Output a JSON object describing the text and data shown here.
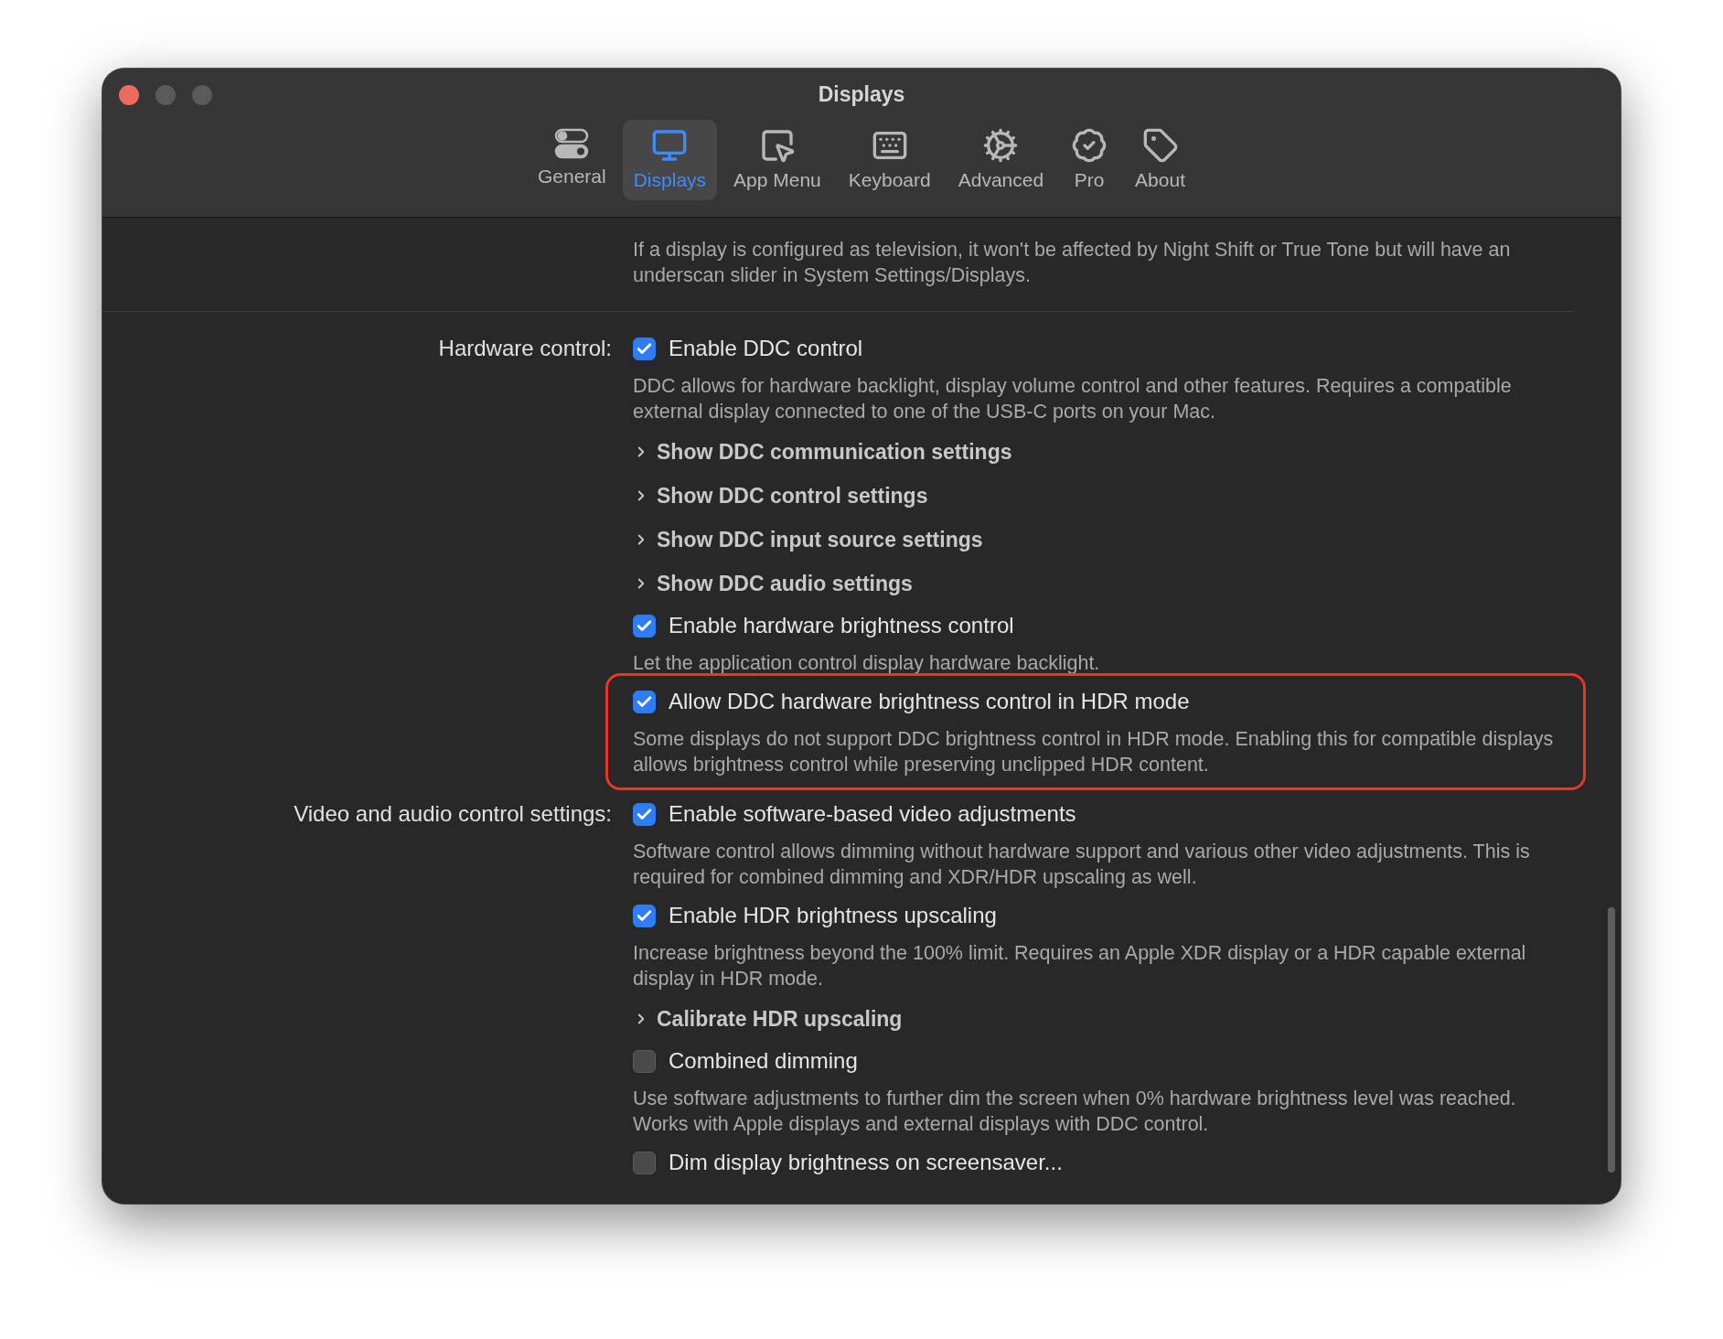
{
  "window": {
    "title": "Displays"
  },
  "tabs": [
    {
      "label": "General",
      "selected": false
    },
    {
      "label": "Displays",
      "selected": true
    },
    {
      "label": "App Menu",
      "selected": false
    },
    {
      "label": "Keyboard",
      "selected": false
    },
    {
      "label": "Advanced",
      "selected": false
    },
    {
      "label": "Pro",
      "selected": false
    },
    {
      "label": "About",
      "selected": false
    }
  ],
  "sections": [
    {
      "items": [
        {
          "kind": "note",
          "description": "If a display is configured as television, it won't be affected by Night Shift or True Tone but will have an underscan slider in System Settings/Displays."
        }
      ]
    },
    {
      "label": "Hardware control:",
      "items": [
        {
          "kind": "checkbox",
          "label": "Enable DDC control",
          "checked": true,
          "highlighted": false,
          "description": "DDC allows for hardware backlight, display volume control and other features. Requires a compatible external display connected to one of the USB-C ports on your Mac."
        },
        {
          "kind": "disclosure",
          "label": "Show DDC communication settings",
          "expanded": false
        },
        {
          "kind": "disclosure",
          "label": "Show DDC control settings",
          "expanded": false
        },
        {
          "kind": "disclosure",
          "label": "Show DDC input source settings",
          "expanded": false
        },
        {
          "kind": "disclosure",
          "label": "Show DDC audio settings",
          "expanded": false
        },
        {
          "kind": "checkbox",
          "label": "Enable hardware brightness control",
          "checked": true,
          "highlighted": false,
          "description": "Let the application control display hardware backlight."
        },
        {
          "kind": "checkbox",
          "label": "Allow DDC hardware brightness control in HDR mode",
          "checked": true,
          "highlighted": true,
          "description": "Some displays do not support DDC brightness control in HDR mode. Enabling this for compatible displays allows brightness control while preserving unclipped HDR content."
        }
      ]
    },
    {
      "label": "Video and audio control settings:",
      "items": [
        {
          "kind": "checkbox",
          "label": "Enable software-based video adjustments",
          "checked": true,
          "highlighted": false,
          "description": "Software control allows dimming without hardware support and  various other video adjustments. This is required for combined dimming and XDR/HDR upscaling as well."
        },
        {
          "kind": "checkbox",
          "label": "Enable HDR brightness upscaling",
          "checked": true,
          "highlighted": false,
          "description": "Increase brightness beyond the 100% limit. Requires an Apple XDR display or a HDR capable external display in HDR mode."
        },
        {
          "kind": "disclosure",
          "label": "Calibrate HDR upscaling",
          "expanded": false
        },
        {
          "kind": "checkbox",
          "label": "Combined dimming",
          "checked": false,
          "highlighted": false,
          "description": "Use software adjustments to further dim the screen when 0% hardware brightness level was reached. Works with Apple displays and external displays with DDC control."
        },
        {
          "kind": "checkbox",
          "label": "Dim display brightness on screensaver...",
          "checked": false,
          "highlighted": false
        }
      ]
    }
  ]
}
